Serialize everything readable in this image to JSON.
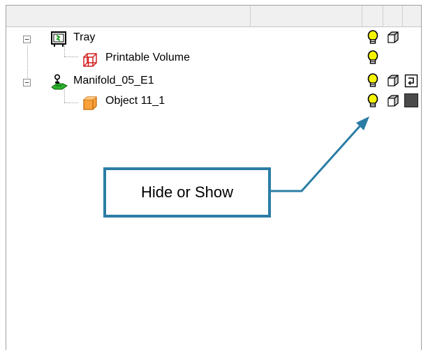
{
  "tree": {
    "items": [
      {
        "label": "Tray"
      },
      {
        "label": "Printable Volume"
      },
      {
        "label": "Manifold_05_E1"
      },
      {
        "label": "Object 11_1"
      }
    ],
    "expander_symbol": "−"
  },
  "callout": {
    "label": "Hide or Show"
  },
  "colors": {
    "accent": "#2b7da5",
    "bulb": "#f5f500",
    "object_box": "#f9a23c",
    "volume_wire": "#d22020"
  },
  "icons": [
    "tray-icon",
    "printable-volume-icon",
    "manifold-icon",
    "object-icon",
    "lightbulb-icon",
    "cube-icon",
    "reset-icon",
    "color-swatch-icon"
  ]
}
